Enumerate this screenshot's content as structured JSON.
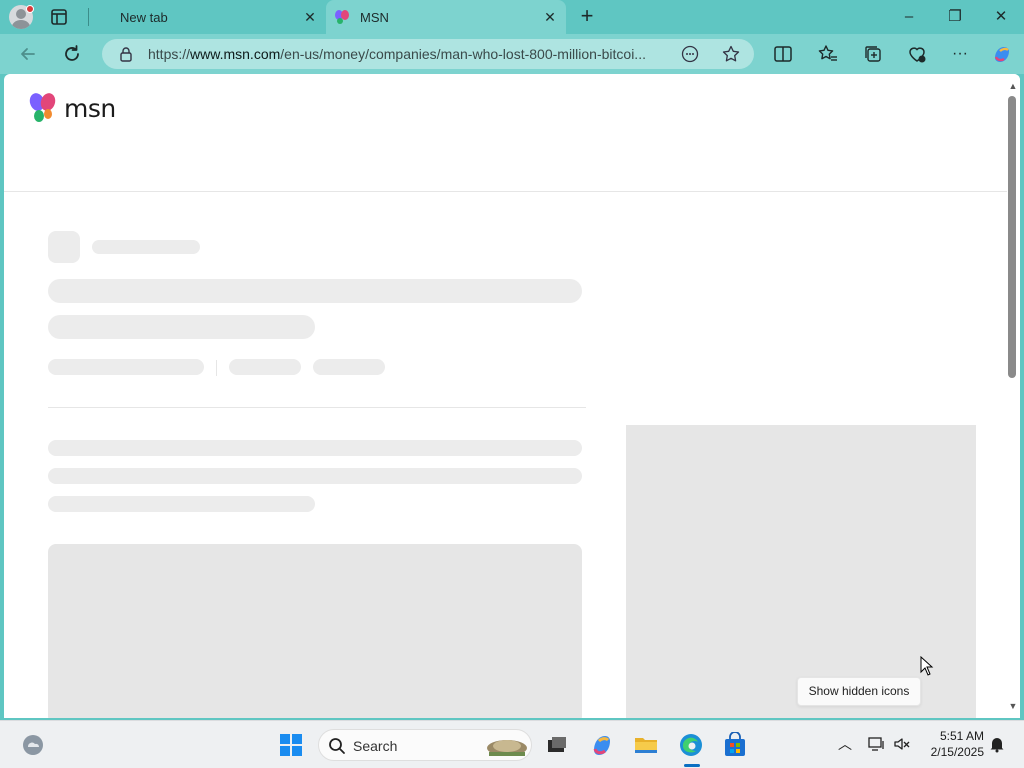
{
  "browser": {
    "tabs": [
      {
        "title": "New tab",
        "active": false
      },
      {
        "title": "MSN",
        "active": true
      }
    ],
    "new_tab_symbol": "+",
    "window_controls": {
      "minimize": "–",
      "restore": "❐",
      "close": "✕"
    },
    "address_bar": {
      "url_prefix": "https://",
      "url_domain": "www.msn.com",
      "url_path": "/en-us/money/companies/man-who-lost-800-million-bitcoi..."
    },
    "toolbar_icons": [
      "back-icon",
      "refresh-icon",
      "lock-icon",
      "read-aloud-icon",
      "favorite-star-icon",
      "split-screen-icon",
      "favorites-icon",
      "collections-icon",
      "browser-essentials-icon",
      "more-icon",
      "copilot-icon"
    ]
  },
  "page": {
    "logo_text": "msn",
    "tooltip": "Show hidden icons"
  },
  "taskbar": {
    "search_label": "Search",
    "clock_time": "5:51 AM",
    "clock_date": "2/15/2025",
    "pinned": [
      "start-icon",
      "search-icon",
      "task-view-icon",
      "copilot-icon",
      "file-explorer-icon",
      "edge-icon",
      "store-icon"
    ],
    "tray": [
      "chevron-up-icon",
      "network-icon",
      "volume-icon",
      "notification-icon"
    ]
  },
  "colors": {
    "frame": "#5fc6c2",
    "toolbar": "#7dd3cf",
    "address": "#aee4e1",
    "skeleton": "#ececec",
    "edge_blue": "#0a6fc2"
  }
}
